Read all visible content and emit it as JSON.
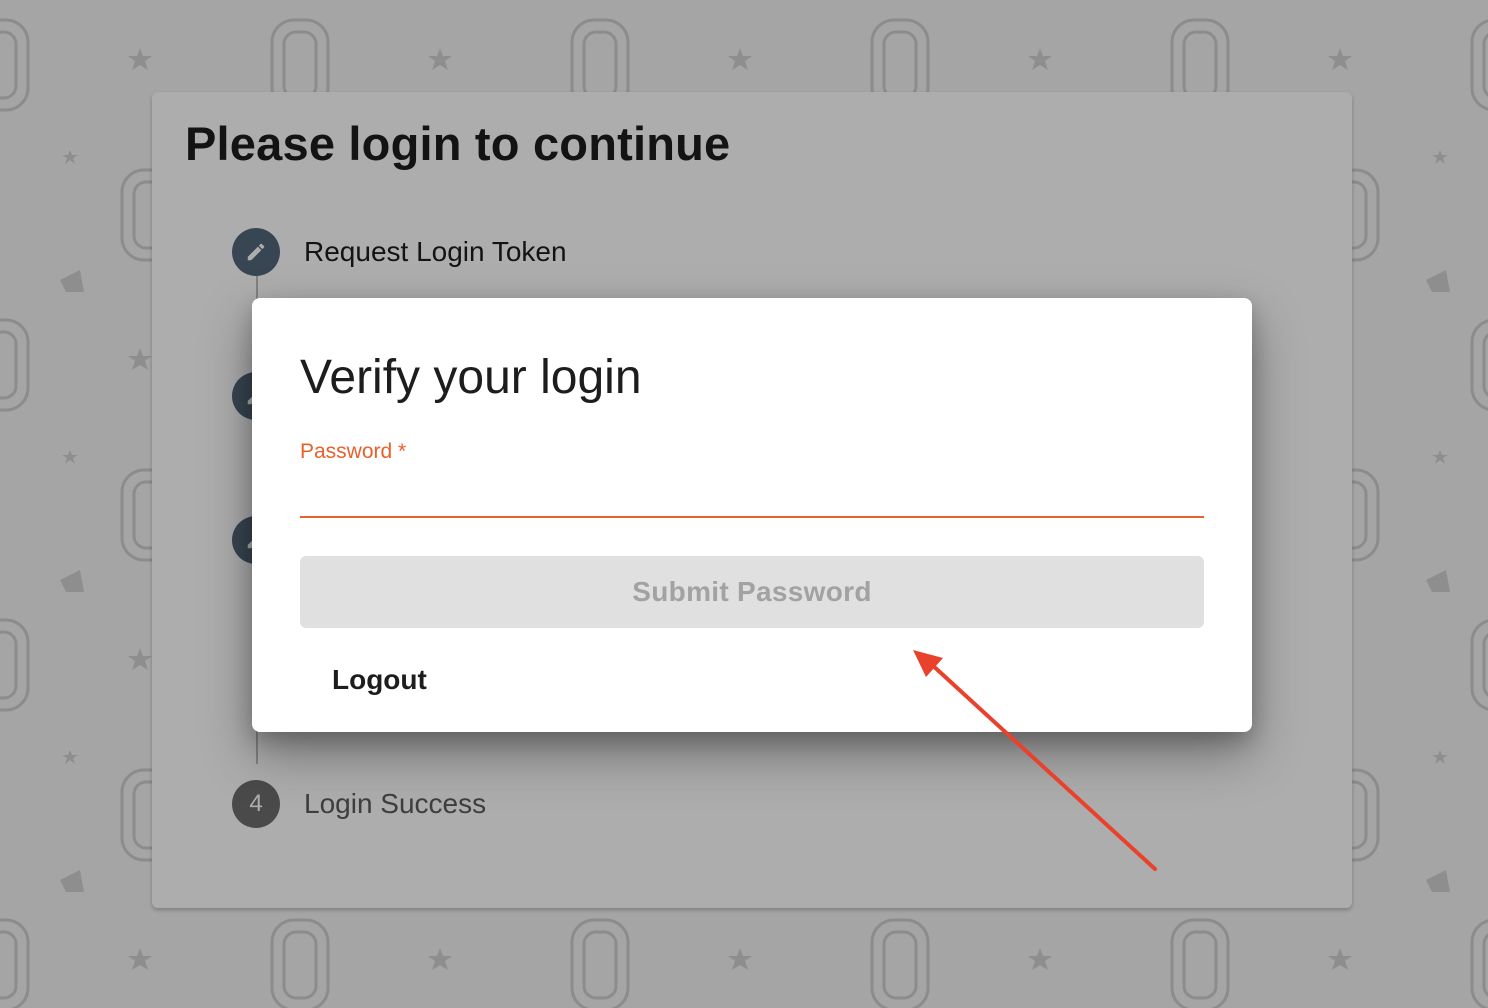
{
  "background": {
    "pattern_icon": "phone-badge-icon",
    "accent_color": "#e8612c"
  },
  "card": {
    "title": "Please login to continue",
    "steps": [
      {
        "icon": "pencil-icon",
        "label": "Request Login Token"
      },
      {
        "icon": "pencil-icon",
        "label": ""
      },
      {
        "icon": "pencil-icon",
        "label": ""
      },
      {
        "icon": "number",
        "number": "4",
        "label": "Login Success"
      }
    ]
  },
  "modal": {
    "title": "Verify your login",
    "password_label": "Password *",
    "password_value": "",
    "submit_label": "Submit Password",
    "logout_label": "Logout"
  },
  "annotation": {
    "type": "arrow",
    "color": "#e8412c"
  }
}
